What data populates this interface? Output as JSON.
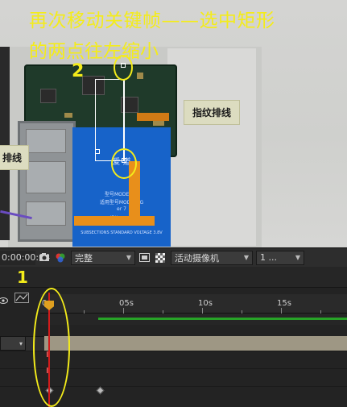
{
  "annotations": {
    "title_line1": "再次移动关键帧——选中矩形",
    "title_line2": "的两点往左缩小",
    "step_2": "2",
    "step_1": "1",
    "tag_fingerprint": "指纹排线",
    "tag_left": "排线"
  },
  "battery_text": {
    "brand": "爱 道",
    "model1": "型号MODEL: H",
    "model2": "适用型号MODEL: G",
    "line3": "er 7",
    "line4": "1.规格MODEL:",
    "footer": "SUBSECTIONS STANDARD VOLTAGE 3.8V"
  },
  "viewer_toolbar": {
    "timecode": "0:00:00:04",
    "camera_icon": "camera-icon",
    "color_icon": "color-channels-icon",
    "resolution": "完整",
    "region_icon": "region-of-interest-icon",
    "transparency_icon": "transparency-grid-icon",
    "active_camera": "活动摄像机",
    "views": "1 ..."
  },
  "timeline": {
    "ruler_labels": [
      "0s",
      "05s",
      "10s",
      "15s"
    ],
    "current_frame": "04",
    "layer_toggle": "▾"
  },
  "colors": {
    "annotation_yellow": "#f4ec1a",
    "playhead_red": "#d21b1b",
    "work_area_green": "#27a327",
    "layer_bar": "#9e9784"
  }
}
